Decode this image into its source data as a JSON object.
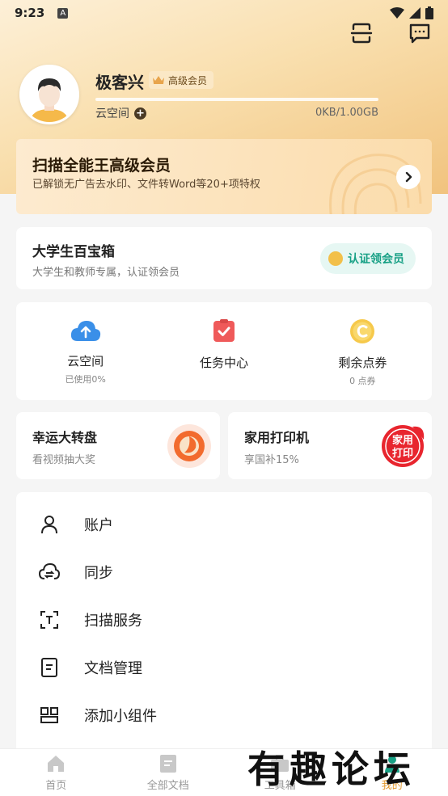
{
  "status_bar": {
    "time": "9:23",
    "notification_letter": "A"
  },
  "profile": {
    "username": "极客兴",
    "vip_label": "高级会员",
    "cloud_label": "云空间",
    "cloud_usage": "0KB/1.00GB",
    "cloud_fraction": 0.0
  },
  "vip_card": {
    "title": "扫描全能王高级会员",
    "desc": "已解锁无广告去水印、文件转Word等20+项特权"
  },
  "student_card": {
    "title": "大学生百宝箱",
    "desc": "大学生和教师专属，认证领会员",
    "button": "认证领会员"
  },
  "quick_actions": [
    {
      "label": "云空间",
      "sub": "已使用0%",
      "icon": "cloud-upload-icon"
    },
    {
      "label": "任务中心",
      "sub": "",
      "icon": "task-icon"
    },
    {
      "label": "剩余点券",
      "sub": "0 点券",
      "icon": "coin-icon"
    }
  ],
  "promos": [
    {
      "title": "幸运大转盘",
      "desc": "看视频抽大奖"
    },
    {
      "title": "家用打印机",
      "desc": "享国补15%",
      "badge": "家用\n打印"
    }
  ],
  "menu": [
    {
      "label": "账户",
      "icon": "user-icon"
    },
    {
      "label": "同步",
      "icon": "cloud-sync-icon"
    },
    {
      "label": "扫描服务",
      "icon": "scan-text-icon"
    },
    {
      "label": "文档管理",
      "icon": "document-icon"
    },
    {
      "label": "添加小组件",
      "icon": "widget-icon"
    }
  ],
  "bottom_nav": [
    {
      "label": "首页",
      "icon": "home-icon",
      "active": false
    },
    {
      "label": "全部文档",
      "icon": "docs-icon",
      "active": false
    },
    {
      "label": "工具箱",
      "icon": "toolbox-icon",
      "active": false
    },
    {
      "label": "我的",
      "icon": "me-icon",
      "active": true
    }
  ],
  "watermark": "有趣论坛",
  "colors": {
    "accent": "#e39a2e",
    "teal": "#17a085",
    "vip_bg": "#fbdcab"
  }
}
